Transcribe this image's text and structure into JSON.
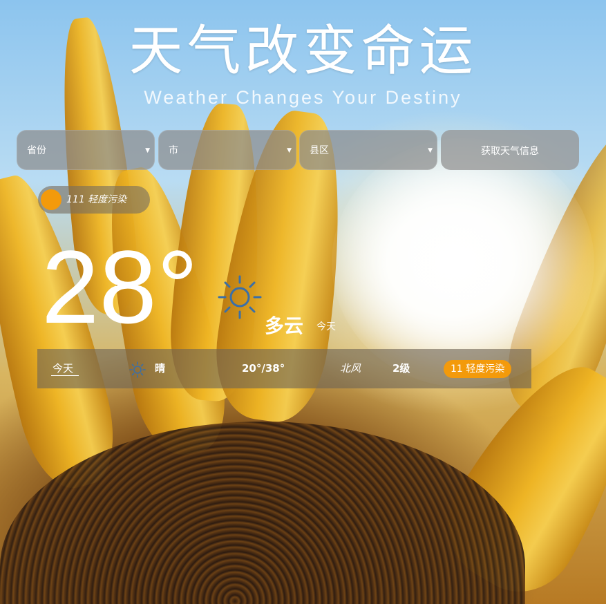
{
  "header": {
    "title": "天气改变命运",
    "subtitle": "Weather Changes Your Destiny"
  },
  "selectors": {
    "province": "省份",
    "city": "市",
    "district": "县区",
    "arrow": "▼",
    "get_button": "获取天气信息"
  },
  "aqi": {
    "text": "111 轻度污染",
    "color": "#f39a0b"
  },
  "current": {
    "temperature": "28°",
    "condition": "多云",
    "note": "今天",
    "icon": "sun-icon"
  },
  "forecast": {
    "day": "今天",
    "icon": "sun-icon",
    "weather": "晴",
    "range": "20°/38°",
    "wind_direction": "北风",
    "wind_level": "2级",
    "aqi_badge": "11 轻度污染"
  },
  "colors": {
    "accent": "#f39a0b",
    "icon": "#3a6fa8"
  }
}
